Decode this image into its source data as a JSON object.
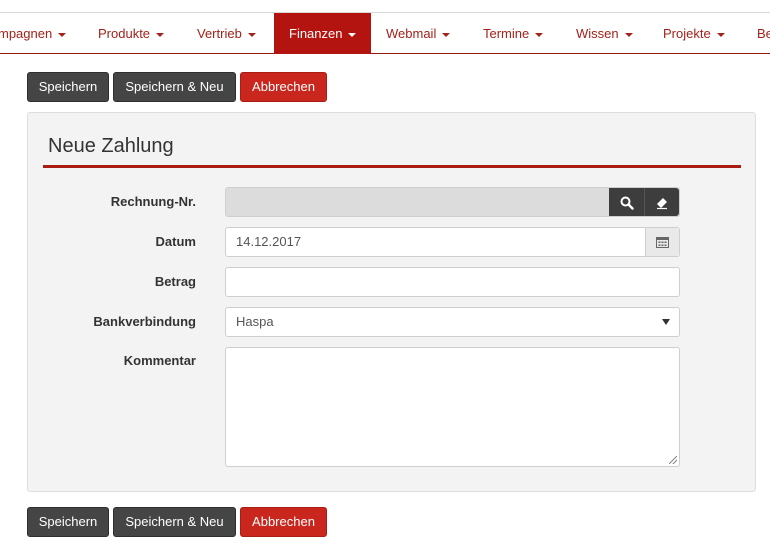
{
  "nav": {
    "items": [
      {
        "label": "mpagnen",
        "active": false
      },
      {
        "label": "Produkte",
        "active": false
      },
      {
        "label": "Vertrieb",
        "active": false
      },
      {
        "label": "Finanzen",
        "active": true
      },
      {
        "label": "Webmail",
        "active": false
      },
      {
        "label": "Termine",
        "active": false
      },
      {
        "label": "Wissen",
        "active": false
      },
      {
        "label": "Projekte",
        "active": false
      },
      {
        "label": "Be",
        "active": false
      }
    ]
  },
  "toolbar": {
    "save_label": "Speichern",
    "save_new_label": "Speichern & Neu",
    "cancel_label": "Abbrechen"
  },
  "form": {
    "title": "Neue Zahlung",
    "invoice_label": "Rechnung-Nr.",
    "invoice_value": "",
    "date_label": "Datum",
    "date_value": "14.12.2017",
    "amount_label": "Betrag",
    "amount_value": "",
    "bank_label": "Bankverbindung",
    "bank_value": "Haspa",
    "comment_label": "Kommentar",
    "comment_value": ""
  },
  "colors": {
    "accent": "#b3140f",
    "dark_button": "#454545",
    "cancel_button": "#c9271d"
  },
  "icons": [
    "search-icon",
    "eraser-icon",
    "calendar-icon",
    "chevron-down-icon"
  ]
}
